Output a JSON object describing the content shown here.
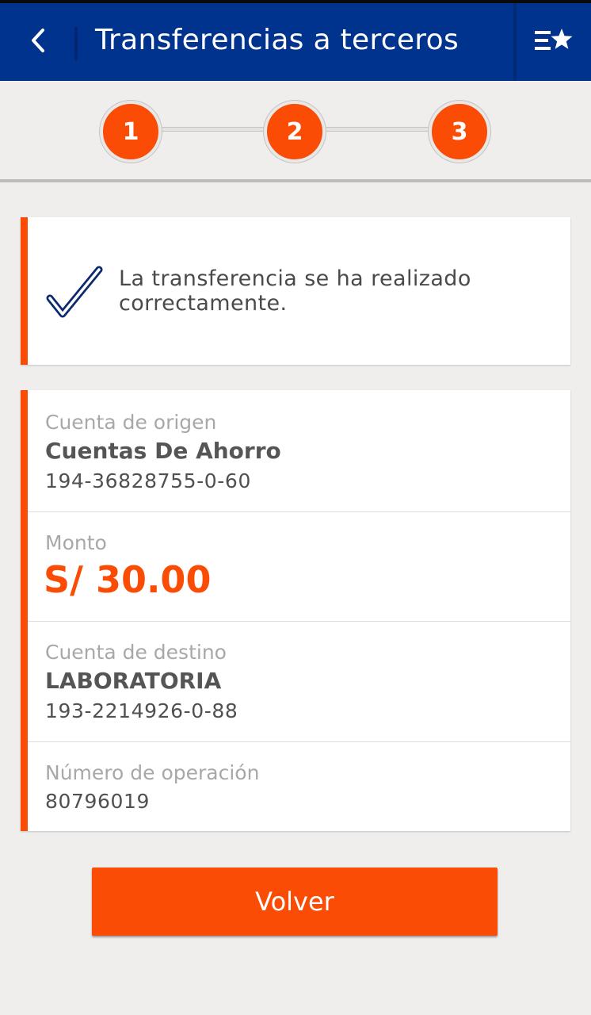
{
  "header": {
    "title": "Transferencias a terceros",
    "back_icon": "chevron-left-icon",
    "favorites_icon": "list-star-icon"
  },
  "stepper": {
    "steps": [
      "1",
      "2",
      "3"
    ],
    "current_step": 3
  },
  "success": {
    "icon": "checkmark-icon",
    "message": "La transferencia se ha realizado correctamente."
  },
  "details": {
    "origin": {
      "label": "Cuenta de origen",
      "name": "Cuentas De Ahorro",
      "number": "194-36828755-0-60"
    },
    "amount": {
      "label": "Monto",
      "value": "S/ 30.00"
    },
    "destination": {
      "label": "Cuenta de destino",
      "name": "LABORATORIA",
      "number": "193-2214926-0-88"
    },
    "operation": {
      "label": "Número de operación",
      "number": "80796019"
    }
  },
  "actions": {
    "back_label": "Volver"
  },
  "colors": {
    "header_bg": "#00338d",
    "accent": "#fa4c05",
    "page_bg": "#efeeec",
    "check_stroke": "#0c2a6b"
  }
}
